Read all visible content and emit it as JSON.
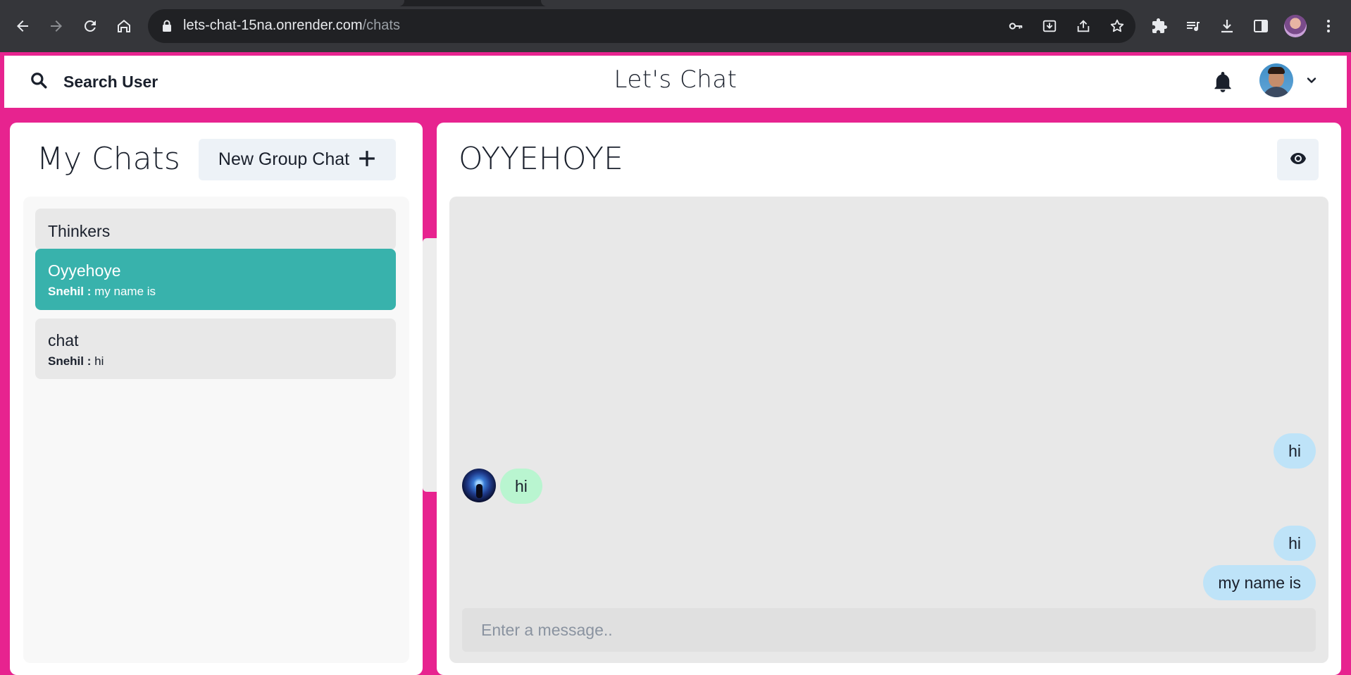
{
  "browser": {
    "url_host": "lets-chat-15na.onrender.com",
    "url_path": "/chats",
    "toolbar_icons": [
      "back-icon",
      "forward-icon",
      "reload-icon",
      "home-icon",
      "lock-icon",
      "key-icon",
      "install-icon",
      "share-icon",
      "star-icon",
      "extensions-icon",
      "media-icon",
      "download-icon",
      "side-panel-icon",
      "profile-avatar",
      "kebab-menu-icon"
    ]
  },
  "header": {
    "search_label": "Search User",
    "app_title": "Let's Chat",
    "icons": [
      "search-icon",
      "bell-icon",
      "chevron-down-icon"
    ]
  },
  "left_panel": {
    "title": "My Chats",
    "new_group_label": "New Group Chat",
    "chats": [
      {
        "name": "Thinkers",
        "latest_sender": "",
        "latest_text": "",
        "active": false
      },
      {
        "name": "Oyyehoye",
        "latest_sender": "Snehil :",
        "latest_text": "my name is",
        "active": true
      },
      {
        "name": "chat",
        "latest_sender": "Snehil :",
        "latest_text": "hi",
        "active": false
      }
    ]
  },
  "right_panel": {
    "chat_title": "OYYEHOYE",
    "view_icon": "eye-icon",
    "messages": [
      {
        "text": "hi",
        "mine": true
      },
      {
        "text": "hi",
        "mine": false
      },
      {
        "text": "hi",
        "mine": true
      },
      {
        "text": "my name is",
        "mine": true
      }
    ],
    "input_placeholder": "Enter a message.."
  },
  "colors": {
    "background": "#e7238f",
    "active_chat": "#38b2ac",
    "my_bubble": "#bee3f8",
    "their_bubble": "#b9f5d0"
  }
}
